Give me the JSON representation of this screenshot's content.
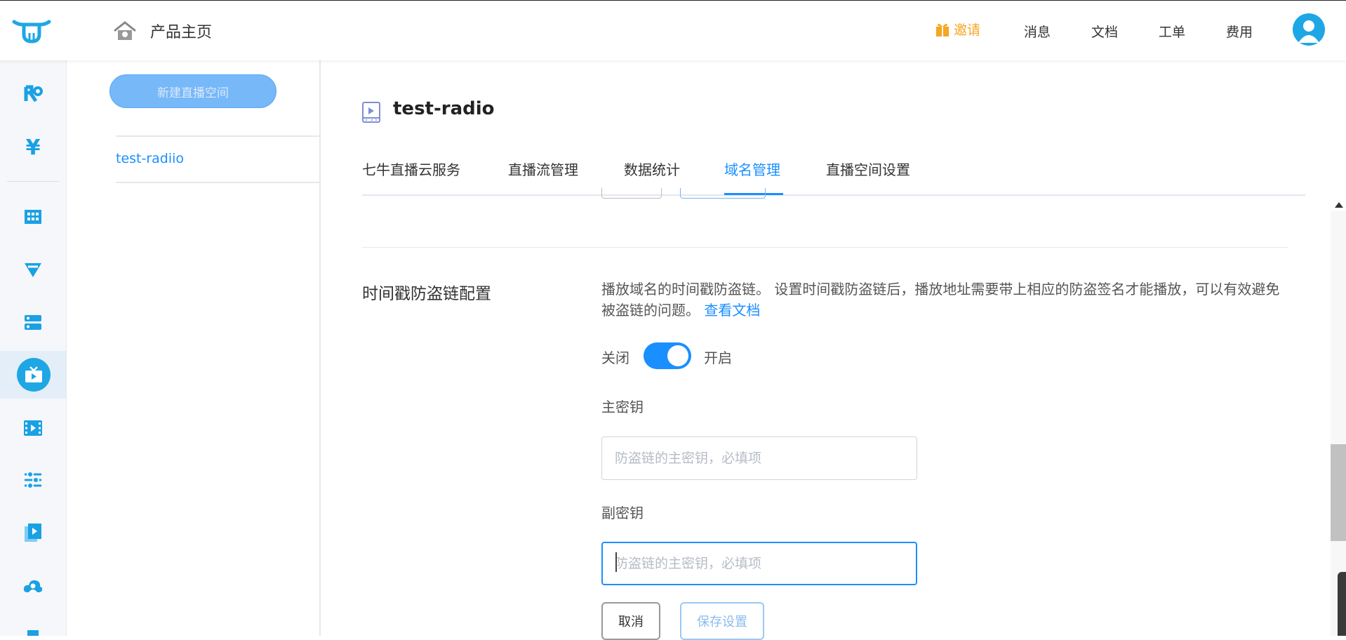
{
  "topbar": {
    "home_label": "产品主页",
    "nav": {
      "invite": "邀请",
      "messages": "消息",
      "docs": "文档",
      "tickets": "工单",
      "billing": "费用"
    },
    "colors": {
      "invite": "#f5a623",
      "accent": "#1a8fff"
    }
  },
  "rail": {
    "icons": [
      "brand-r-icon",
      "yen-icon",
      "grid-icon",
      "funnel-icon",
      "stack-icon",
      "live-tv-icon",
      "film-icon",
      "sliders-icon",
      "video-file-icon",
      "cloud-user-icon"
    ],
    "active": "live-tv-icon"
  },
  "spaces": {
    "new_button": "新建直播空间",
    "items": [
      "test-radiio"
    ]
  },
  "main": {
    "title": "test-radio",
    "tabs": [
      "七牛直播云服务",
      "直播流管理",
      "数据统计",
      "域名管理",
      "直播空间设置"
    ],
    "active_tab": "域名管理",
    "section": {
      "title": "时间戳防盗链配置",
      "desc_text": "播放域名的时间戳防盗链。 设置时间戳防盗链后，播放地址需要带上相应的防盗签名才能播放，可以有效避免被盗链的问题。",
      "desc_link": "查看文档",
      "toggle_off": "关闭",
      "toggle_on": "开启",
      "toggle_state": "on",
      "primary_key_label": "主密钥",
      "primary_key_placeholder": "防盗链的主密钥，必填项",
      "secondary_key_label": "副密钥",
      "secondary_key_placeholder": "防盗链的主密钥，必填项",
      "cancel": "取消",
      "save": "保存设置"
    }
  }
}
